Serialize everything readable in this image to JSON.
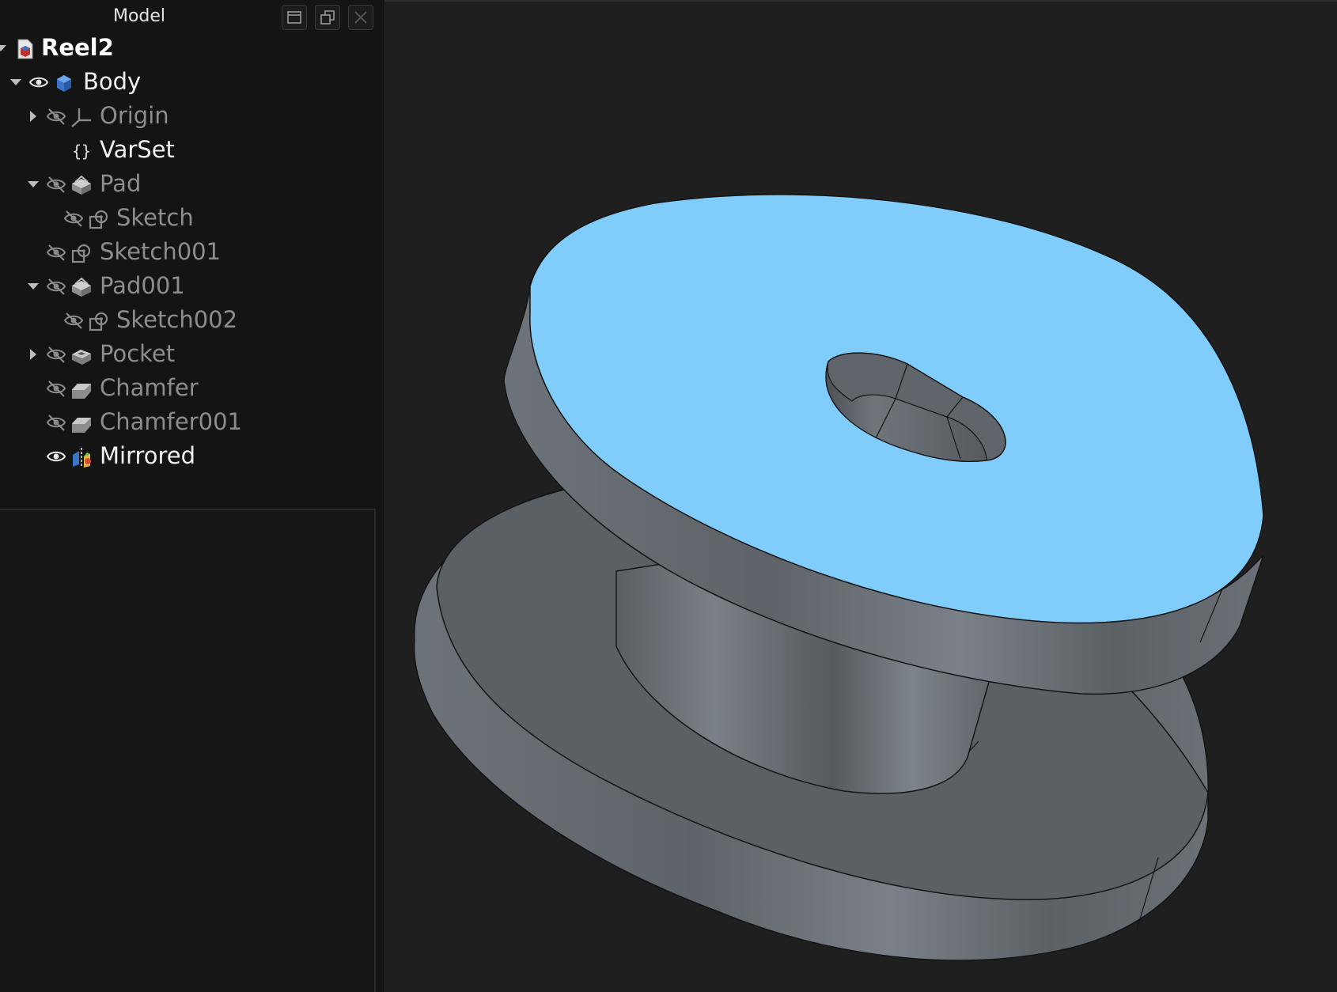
{
  "panel": {
    "title": "Model"
  },
  "tree": [
    {
      "label": "Reel2",
      "icon": "document-icon",
      "expander": "partial",
      "visible": null,
      "style": "bold"
    },
    {
      "label": "Body",
      "icon": "body-icon",
      "expander": "expanded",
      "visible": true,
      "style": "bright"
    },
    {
      "label": "Origin",
      "icon": "origin-axes-icon",
      "expander": "collapsed",
      "visible": false,
      "style": "dim"
    },
    {
      "label": "VarSet",
      "icon": "braces-icon",
      "expander": null,
      "visible": null,
      "style": "bright"
    },
    {
      "label": "Pad",
      "icon": "pad-icon",
      "expander": "expanded",
      "visible": false,
      "style": "dim"
    },
    {
      "label": "Sketch",
      "icon": "sketch-icon",
      "expander": null,
      "visible": false,
      "style": "dim"
    },
    {
      "label": "Sketch001",
      "icon": "sketch-icon",
      "expander": null,
      "visible": false,
      "style": "dim"
    },
    {
      "label": "Pad001",
      "icon": "pad-icon",
      "expander": "expanded",
      "visible": false,
      "style": "dim"
    },
    {
      "label": "Sketch002",
      "icon": "sketch-icon",
      "expander": null,
      "visible": false,
      "style": "dim"
    },
    {
      "label": "Pocket",
      "icon": "pocket-icon",
      "expander": "collapsed",
      "visible": false,
      "style": "dim"
    },
    {
      "label": "Chamfer",
      "icon": "chamfer-icon",
      "expander": null,
      "visible": false,
      "style": "dim"
    },
    {
      "label": "Chamfer001",
      "icon": "chamfer-icon",
      "expander": null,
      "visible": false,
      "style": "dim"
    },
    {
      "label": "Mirrored",
      "icon": "mirrored-icon",
      "expander": null,
      "visible": true,
      "style": "bright"
    }
  ],
  "colors": {
    "selected_face": "#80ccfa",
    "part_side": "#5f656b",
    "part_dark": "#4f5357",
    "edge": "#141414",
    "viewport_bg": "#1f1f1f",
    "panel_bg": "#141414"
  }
}
